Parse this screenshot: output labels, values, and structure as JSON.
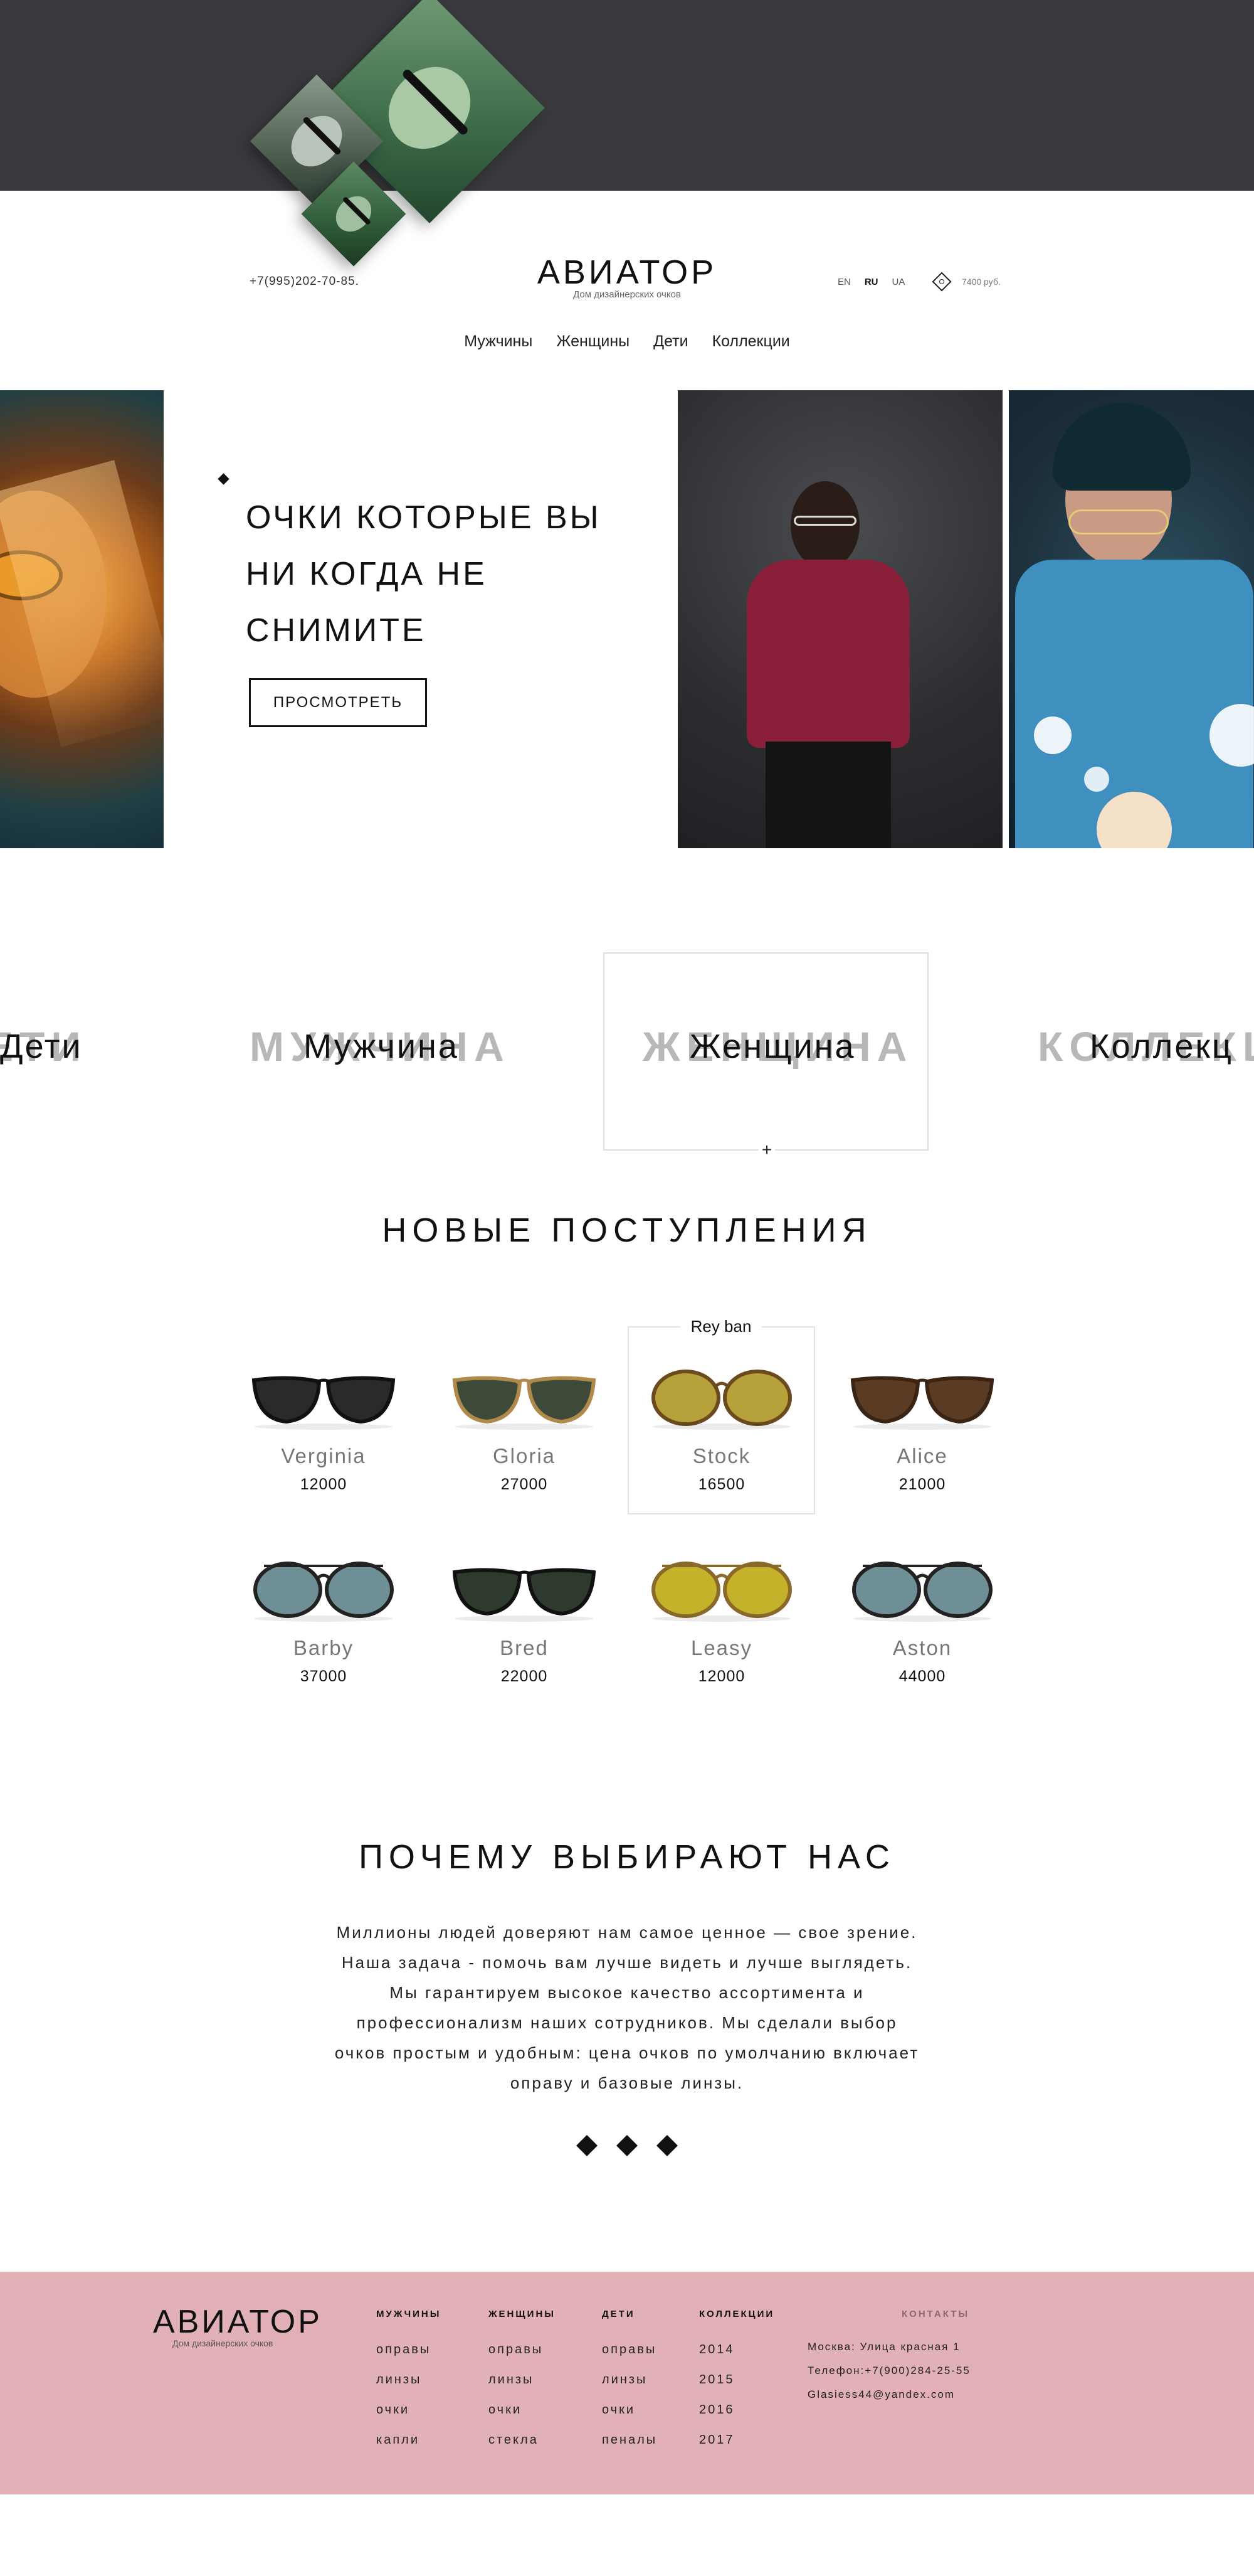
{
  "header": {
    "phone": "+7(995)202-70-85.",
    "brand": "АВИАТОР",
    "brand_sub": "Дом дизайнерских очков",
    "langs": [
      "EN",
      "RU",
      "UA"
    ],
    "active_lang": "RU",
    "cart_sum": "7400 руб.",
    "cart_icon": "diamond-cart-icon"
  },
  "nav": [
    "Мужчины",
    "Женщины",
    "Дети",
    "Коллекции"
  ],
  "hero": {
    "title_lines": [
      "ОЧКИ КОТОРЫЕ ВЫ",
      "НИ КОГДА НЕ",
      "СНИМИТЕ"
    ],
    "button": "ПРОСМОТРЕТЬ"
  },
  "categories": {
    "ghost": [
      "ДЕТИ",
      "МУЖЧИНА",
      "ЖЕНЩИНА",
      "КОЛЛЕКЦИИ"
    ],
    "labels": [
      "Дети",
      "Мужчина",
      "Женщина",
      "Коллекц"
    ],
    "plus": "+"
  },
  "new_arrivals": {
    "title": "НОВЫЕ ПОСТУПЛЕНИЯ",
    "highlight_brand": "Rey ban",
    "products": [
      {
        "name": "Verginia",
        "price": "12000",
        "lens": "#2a2a2a",
        "frame": "#111111"
      },
      {
        "name": "Gloria",
        "price": "27000",
        "lens": "#3d4a3a",
        "frame": "#b08a4a"
      },
      {
        "name": "Stock",
        "price": "16500",
        "lens": "#b7a13a",
        "frame": "#6b4a1e"
      },
      {
        "name": "Alice",
        "price": "21000",
        "lens": "#5a3b24",
        "frame": "#3a2414"
      },
      {
        "name": "Barby",
        "price": "37000",
        "lens": "#6f8f96",
        "frame": "#222222"
      },
      {
        "name": "Bred",
        "price": "22000",
        "lens": "#2f3a2e",
        "frame": "#111111"
      },
      {
        "name": "Leasy",
        "price": "12000",
        "lens": "#c6b12a",
        "frame": "#8a6a2a"
      },
      {
        "name": "Aston",
        "price": "44000",
        "lens": "#6f8f96",
        "frame": "#222222"
      }
    ]
  },
  "why": {
    "title": "ПОЧЕМУ ВЫБИРАЮТ НАС",
    "lines": [
      "Миллионы людей доверяют нам самое ценное — свое зрение.",
      "Наша задача - помочь вам лучше видеть и лучше выглядеть.",
      "Мы гарантируем высокое качество ассортимента и",
      "профессионализм наших сотрудников. Мы сделали выбор",
      "очков простым и удобным: цена очков по умолчанию включает",
      "оправу и базовые линзы."
    ]
  },
  "footer": {
    "brand": "АВИАТОР",
    "brand_sub": "Дом дизайнерских очков",
    "columns": [
      {
        "title": "МУЖЧИНЫ",
        "items": [
          "оправы",
          "линзы",
          "очки",
          "капли"
        ]
      },
      {
        "title": "ЖЕНЩИНЫ",
        "items": [
          "оправы",
          "линзы",
          "очки",
          "стекла"
        ]
      },
      {
        "title": "ДЕТИ",
        "items": [
          "оправы",
          "линзы",
          "очки",
          "пеналы"
        ]
      },
      {
        "title": "КОЛЛЕКЦИИ",
        "items": [
          "2014",
          "2015",
          "2016",
          "2017"
        ]
      }
    ],
    "contacts_title": "КОНТАКТЫ",
    "contacts": [
      "Москва: Улица красная 1",
      "Телефон:+7(900)284-25-55",
      "Glasiess44@yandex.com"
    ]
  },
  "colors": {
    "top_band": "#3a3a3e",
    "footer_bg": "#e2b1b7",
    "ghost_text": "#b8b8b8"
  }
}
